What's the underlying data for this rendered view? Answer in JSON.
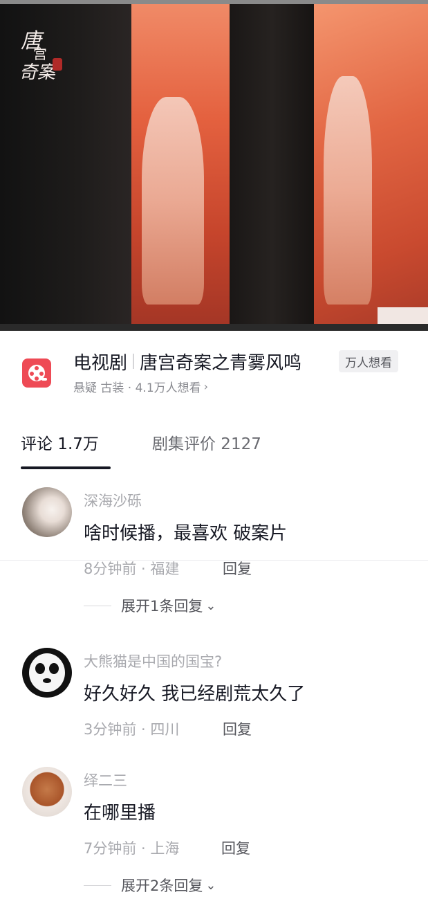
{
  "video": {
    "logo_text": "唐宫奇案之青雾风鸣"
  },
  "drama": {
    "category": "电视剧",
    "title": "唐宫奇案之青雾风鸣",
    "badge": "万人想看",
    "subtitle": "悬疑 古装 · 4.1万人想看",
    "icon": "film-reel-icon",
    "accent_color": "#ee4a55"
  },
  "tabs": [
    {
      "label": "评论 1.7万",
      "active": true
    },
    {
      "label": "剧集评价 2127",
      "active": false
    }
  ],
  "comments": [
    {
      "user": "深海沙砾",
      "text": "啥时候播，最喜欢 破案片",
      "meta": "8分钟前 · 福建",
      "reply_label": "回复",
      "expand_label": "展开1条回复"
    },
    {
      "user": "大熊猫是中国的国宝?",
      "text": "好久好久 我已经剧荒太久了",
      "meta": "3分钟前 · 四川",
      "reply_label": "回复",
      "expand_label": ""
    },
    {
      "user": "绎二三",
      "text": "在哪里播",
      "meta": "7分钟前 · 上海",
      "reply_label": "回复",
      "expand_label": "展开2条回复"
    }
  ]
}
